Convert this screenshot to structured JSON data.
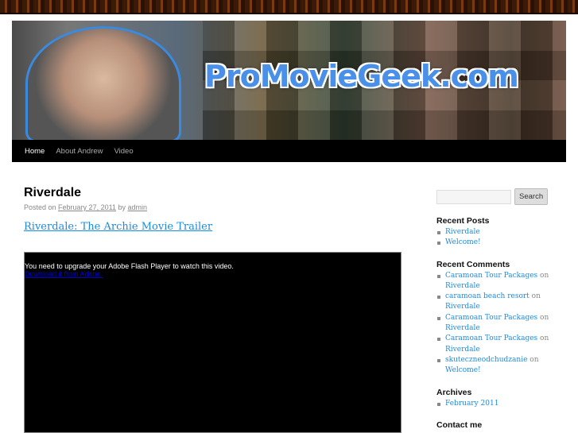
{
  "site": {
    "logo_text": "ProMovieGeek.com"
  },
  "nav": [
    "Home",
    "About Andrew",
    "Video"
  ],
  "post": {
    "title": "Riverdale",
    "posted_on": "Posted on",
    "date": "February 27, 2011",
    "by": "by",
    "author": "admin",
    "link": "Riverdale: The Archie Movie Trailer",
    "flash_msg": "You need to upgrade your Adobe Flash Player to watch this video.",
    "flash_link": "Download it from Adobe."
  },
  "sidebar": {
    "search_button": "Search",
    "recent_posts_title": "Recent Posts",
    "recent_posts": [
      "Riverdale",
      "Welcome!"
    ],
    "recent_comments_title": "Recent Comments",
    "on": "on",
    "recent_comments": [
      {
        "author": "Caramoan Tour Packages",
        "post": "Riverdale"
      },
      {
        "author": "caramoan beach resort",
        "post": "Riverdale"
      },
      {
        "author": "Caramoan Tour Packages",
        "post": "Riverdale"
      },
      {
        "author": "Caramoan Tour Packages",
        "post": "Riverdale"
      },
      {
        "author": "skuteczneodchudzanie",
        "post": "Welcome!"
      }
    ],
    "archives_title": "Archives",
    "archives": [
      "February 2011"
    ],
    "contact_title": "Contact me"
  }
}
